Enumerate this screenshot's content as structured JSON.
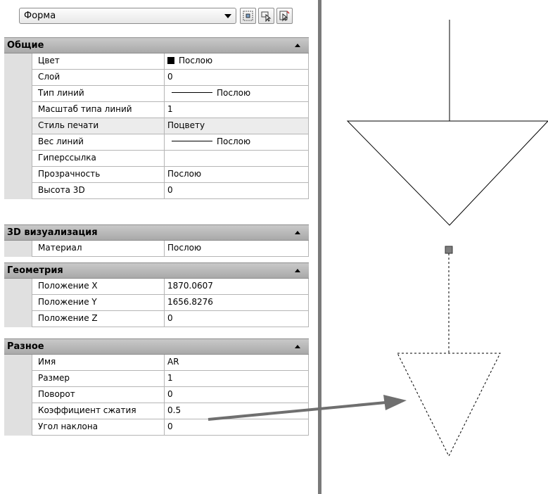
{
  "combo": {
    "selected": "Форма"
  },
  "toolbar": {
    "icons": [
      "quick-select-icon",
      "select-objects-icon",
      "toggle-pickadd-icon"
    ]
  },
  "sections": [
    {
      "title": "Общие",
      "rows": [
        {
          "name": "Цвет",
          "value": "Послою",
          "kind": "color"
        },
        {
          "name": "Слой",
          "value": "0"
        },
        {
          "name": "Тип линий",
          "value": "Послою",
          "kind": "linetype"
        },
        {
          "name": "Масштаб типа линий",
          "value": "1"
        },
        {
          "name": "Стиль печати",
          "value": "Поцвету",
          "shaded": true
        },
        {
          "name": "Вес линий",
          "value": "Послою",
          "kind": "linetype"
        },
        {
          "name": "Гиперссылка",
          "value": ""
        },
        {
          "name": "Прозрачность",
          "value": "Послою"
        },
        {
          "name": "Высота 3D",
          "value": "0"
        }
      ]
    },
    {
      "title": "3D визуализация",
      "rows": [
        {
          "name": "Материал",
          "value": "Послою"
        }
      ]
    },
    {
      "title": "Геометрия",
      "rows": [
        {
          "name": "Положение X",
          "value": "1870.0607"
        },
        {
          "name": "Положение Y",
          "value": "1656.8276"
        },
        {
          "name": "Положение Z",
          "value": "0"
        }
      ]
    },
    {
      "title": "Разное",
      "rows": [
        {
          "name": "Имя",
          "value": "AR"
        },
        {
          "name": "Размер",
          "value": "1"
        },
        {
          "name": "Поворот",
          "value": "0"
        },
        {
          "name": "Коэффициент сжатия",
          "value": "0.5"
        },
        {
          "name": "Угол наклона",
          "value": "0"
        }
      ]
    }
  ],
  "colors": {
    "section_header": "#b9b9b9",
    "arrow": "#6f6f6f",
    "panel_border": "#7a7a7a"
  }
}
